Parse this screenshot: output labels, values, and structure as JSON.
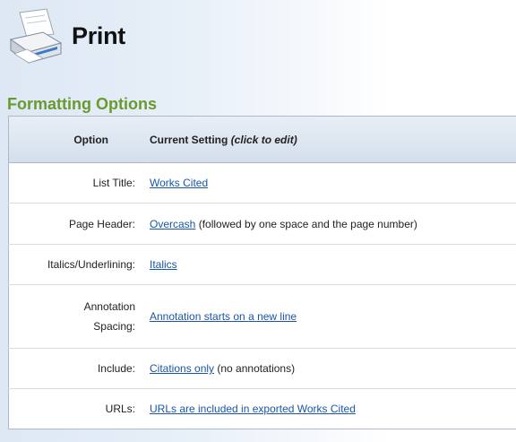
{
  "page": {
    "title": "Print"
  },
  "section": {
    "title": "Formatting Options"
  },
  "table": {
    "headers": {
      "option": "Option",
      "setting": "Current Setting",
      "setting_hint": "(click to edit)"
    },
    "rows": [
      {
        "label": "List Title:",
        "link": "Works Cited",
        "suffix": ""
      },
      {
        "label": "Page Header:",
        "link": "Overcash",
        "suffix": " (followed by one space and the page number)"
      },
      {
        "label": "Italics/Underlining:",
        "link": "Italics",
        "suffix": ""
      },
      {
        "label": "Annotation Spacing:",
        "link": "Annotation starts on a new line",
        "suffix": ""
      },
      {
        "label": "Include:",
        "link": "Citations only",
        "suffix": " (no annotations)"
      },
      {
        "label": "URLs:",
        "link": "URLs are included in exported Works Cited",
        "suffix": ""
      }
    ]
  },
  "colors": {
    "section_title": "#6a9a2e",
    "link": "#1a56a8",
    "header_gradient_start": "#dde8f4"
  },
  "icons": {
    "printer": "printer-icon"
  }
}
